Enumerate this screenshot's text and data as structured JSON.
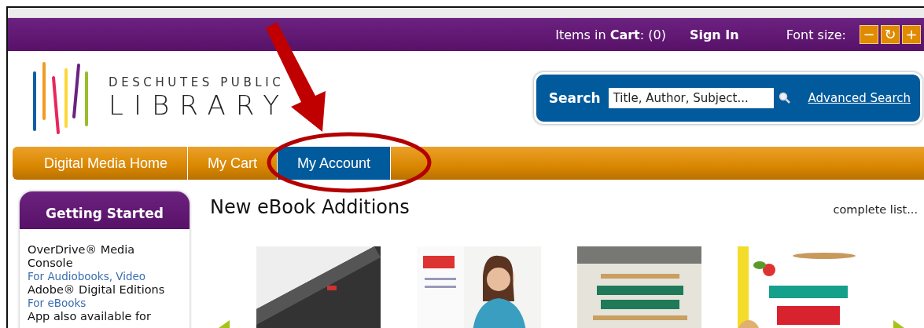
{
  "top_bar": {
    "cart_prefix": "Items in ",
    "cart_bold": "Cart",
    "cart_count": ": (0)",
    "sign_in": "Sign In",
    "font_size_label": "Font size:",
    "font_buttons": [
      "−",
      "↻",
      "+"
    ]
  },
  "logo": {
    "line1": "DESCHUTES PUBLIC",
    "line2": "LIBRARY"
  },
  "search": {
    "label": "Search",
    "placeholder": "Title, Author, Subject...",
    "advanced_link": "Advanced Search"
  },
  "tabs": [
    {
      "label": "Digital Media Home",
      "selected": false
    },
    {
      "label": "My Cart",
      "selected": false
    },
    {
      "label": "My Account",
      "selected": true
    }
  ],
  "sidebar": {
    "title": "Getting Started",
    "items": [
      {
        "kind": "title",
        "text": "OverDrive® Media Console"
      },
      {
        "kind": "subtitle",
        "text": "For Audiobooks, Video"
      },
      {
        "kind": "title",
        "text": "Adobe® Digital Editions"
      },
      {
        "kind": "subtitle",
        "text": "For eBooks"
      },
      {
        "kind": "title",
        "text": "App also available for"
      }
    ]
  },
  "main": {
    "heading": "New eBook Additions",
    "complete_list_link": "complete list..."
  }
}
